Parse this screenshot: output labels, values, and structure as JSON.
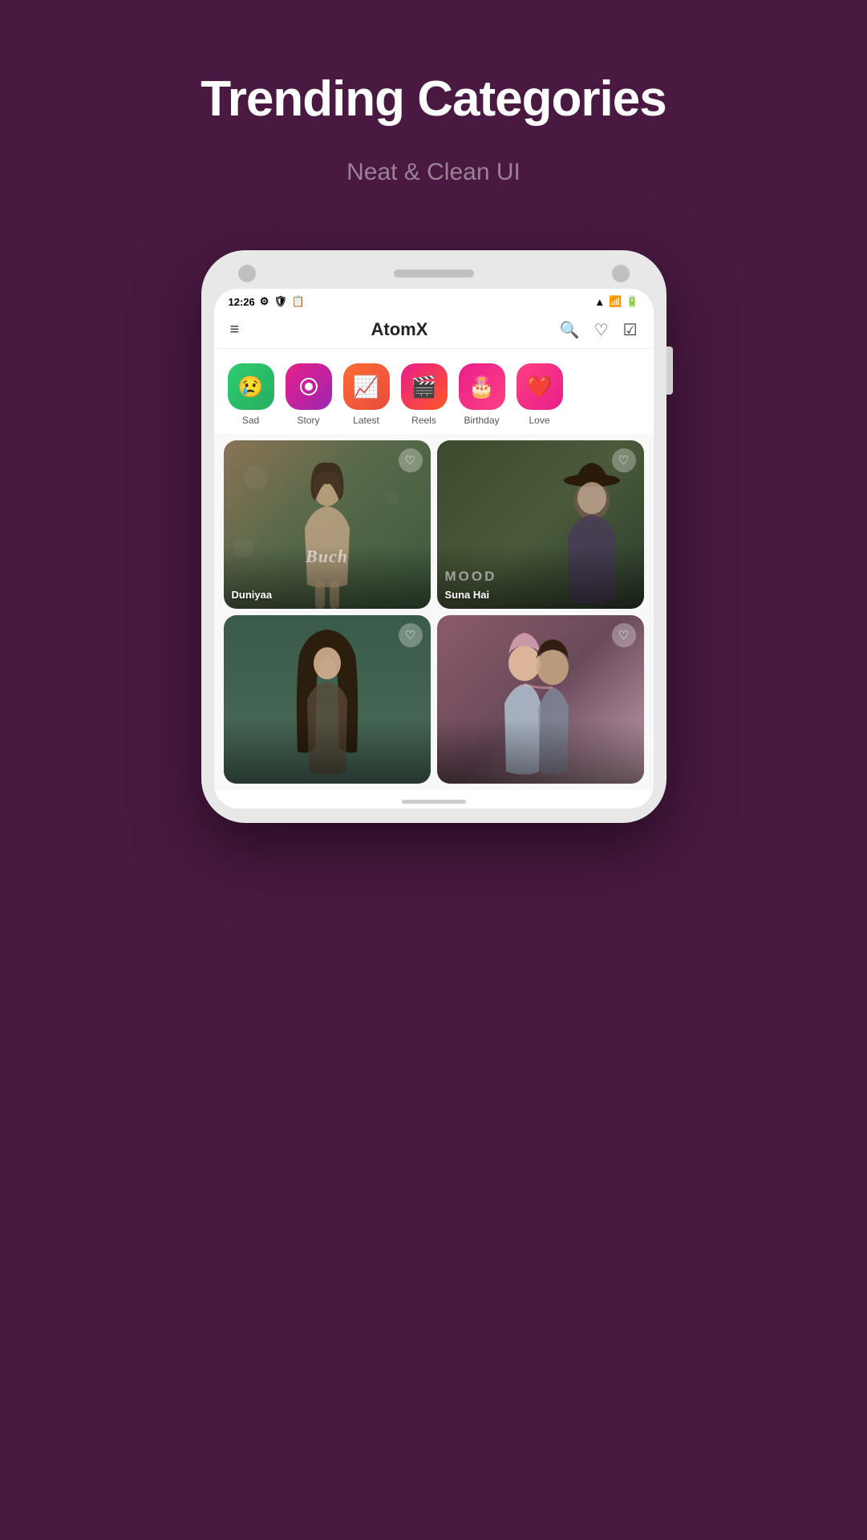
{
  "page": {
    "title": "Trending Categories",
    "subtitle": "Neat & Clean UI",
    "background_color": "#4a1942"
  },
  "app": {
    "name": "AtomX",
    "time": "12:26"
  },
  "categories": [
    {
      "id": "sad",
      "label": "Sad",
      "emoji": "😢",
      "css_class": "cat-sad"
    },
    {
      "id": "story",
      "label": "Story",
      "emoji": "📷",
      "css_class": "cat-story"
    },
    {
      "id": "latest",
      "label": "Latest",
      "emoji": "📈",
      "css_class": "cat-latest"
    },
    {
      "id": "reels",
      "label": "Reels",
      "emoji": "🎬",
      "css_class": "cat-reels"
    },
    {
      "id": "birthday",
      "label": "Birthday",
      "emoji": "🎂",
      "css_class": "cat-birthday"
    },
    {
      "id": "love",
      "label": "Love",
      "emoji": "❤️",
      "css_class": "cat-love"
    }
  ],
  "cards": [
    {
      "id": "card-1",
      "title": "Duniyaa",
      "css_class": "card-1"
    },
    {
      "id": "card-2",
      "title": "Suna Hai",
      "css_class": "card-2",
      "tag": "MOOD"
    },
    {
      "id": "card-3",
      "title": "",
      "css_class": "card-3"
    },
    {
      "id": "card-4",
      "title": "",
      "css_class": "card-4"
    }
  ],
  "icons": {
    "menu": "≡",
    "search": "🔍",
    "heart": "♡",
    "bookmark": "☑",
    "heart_filled": "♡"
  }
}
